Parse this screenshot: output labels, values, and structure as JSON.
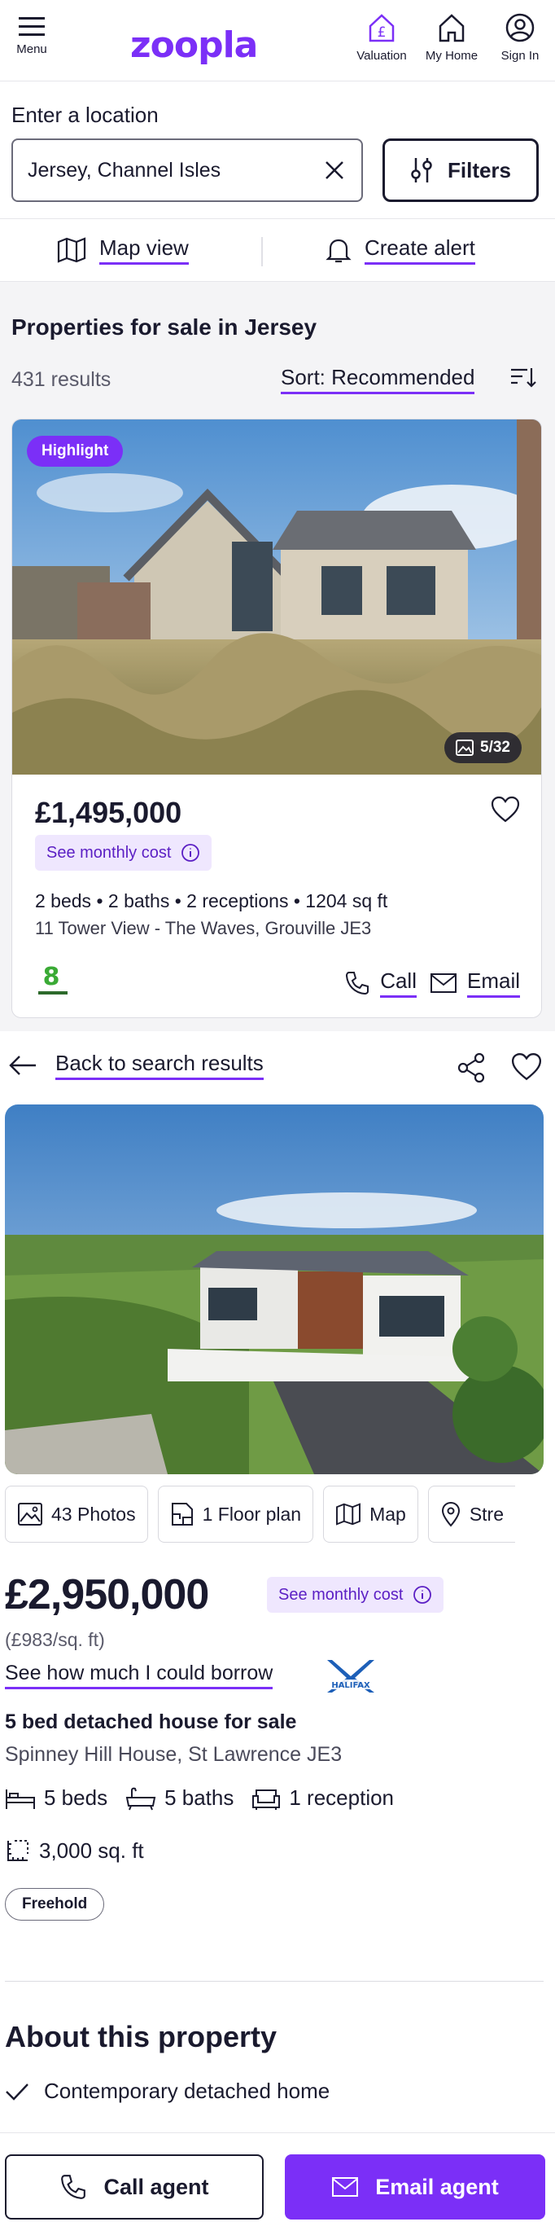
{
  "header": {
    "menu_label": "Menu",
    "logo": "zoopla",
    "nav": [
      {
        "label": "Valuation",
        "icon": "pound-house-icon"
      },
      {
        "label": "My Home",
        "icon": "home-icon"
      },
      {
        "label": "Sign In",
        "icon": "user-icon"
      }
    ]
  },
  "search": {
    "label": "Enter a location",
    "value": "Jersey, Channel Isles",
    "filters_label": "Filters"
  },
  "actions": {
    "map_view": "Map view",
    "create_alert": "Create alert"
  },
  "results": {
    "title": "Properties for sale in Jersey",
    "count": "431 results",
    "sort": "Sort: Recommended"
  },
  "card": {
    "badge": "Highlight",
    "photo_count": "5/32",
    "price": "£1,495,000",
    "monthly": "See monthly cost",
    "meta": "2 beds • 2 baths • 2 receptions • 1204 sq ft",
    "address": "11 Tower View - The Waves, Grouville JE3",
    "call": "Call",
    "email": "Email"
  },
  "detail": {
    "back": "Back to search results",
    "media": [
      {
        "label": "43 Photos",
        "icon": "photo-icon"
      },
      {
        "label": "1 Floor plan",
        "icon": "floorplan-icon"
      },
      {
        "label": "Map",
        "icon": "map-icon"
      },
      {
        "label": "Stre",
        "icon": "pin-icon"
      }
    ],
    "price": "£2,950,000",
    "monthly": "See monthly cost",
    "price_per_sqft": "(£983/sq. ft)",
    "borrow": "See how much I could borrow",
    "borrow_brand": "HALIFAX",
    "type": "5 bed detached house for sale",
    "address": "Spinney Hill House, St Lawrence JE3",
    "beds": "5 beds",
    "baths": "5 baths",
    "receptions": "1 reception",
    "area": "3,000 sq. ft",
    "tenure": "Freehold",
    "about_title": "About this property",
    "about_bullet": "Contemporary detached home"
  },
  "footer": {
    "call_agent": "Call agent",
    "email_agent": "Email agent"
  },
  "colors": {
    "brand": "#7b2ff7",
    "text": "#1a1a2e",
    "muted": "#5a5a6a",
    "chip_bg": "#efe7fe"
  }
}
